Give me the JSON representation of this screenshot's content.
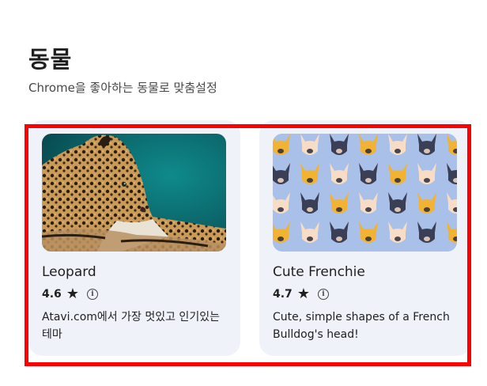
{
  "header": {
    "title": "동물",
    "subtitle": "Chrome을 좋아하는 동물로 맞춤설정"
  },
  "cards": [
    {
      "title": "Leopard",
      "rating": "4.6",
      "star_icon": "star-icon",
      "info_icon": "info-icon",
      "description": "Atavi.com에서 가장 멋있고 인기있는 테마"
    },
    {
      "title": "Cute Frenchie",
      "rating": "4.7",
      "star_icon": "star-icon",
      "info_icon": "info-icon",
      "description": "Cute, simple shapes of a French Bulldog's head!"
    }
  ],
  "colors": {
    "card_background": "#eff2f8",
    "highlight": "#ff0000",
    "frenchie_background": "#a9c0e8",
    "frenchie_yellow": "#f2b233",
    "frenchie_cream": "#f7dcc6",
    "frenchie_navy": "#3b3f55"
  }
}
